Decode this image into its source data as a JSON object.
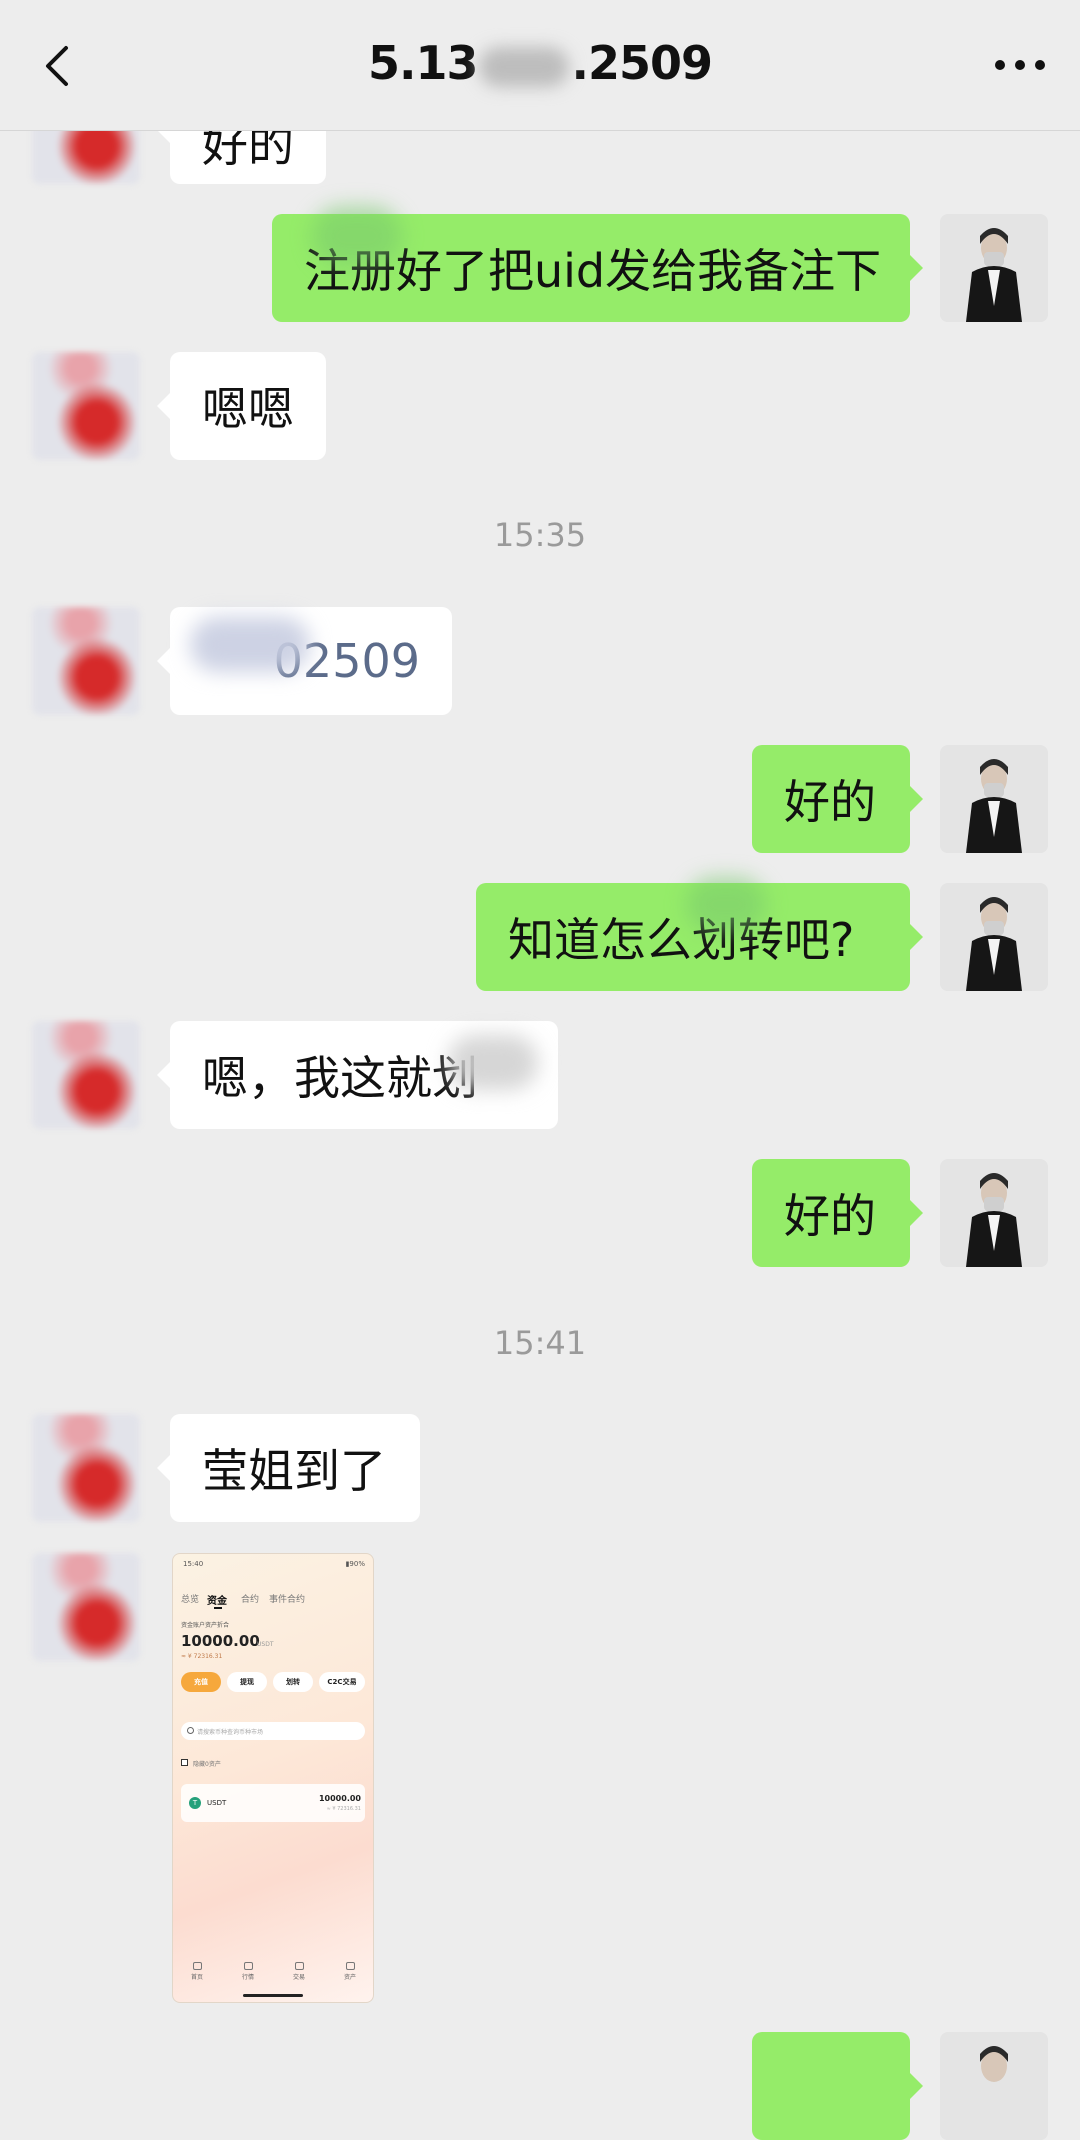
{
  "header": {
    "back_icon": "chevron-left-icon",
    "title_prefix": "5.13",
    "title_suffix": ".2509",
    "more_icon": "more-dots-icon"
  },
  "messages": [
    {
      "side": "left",
      "text": "好的"
    },
    {
      "side": "right",
      "text": "注册好了把uid发给我备注下"
    },
    {
      "side": "left",
      "text": "嗯嗯"
    },
    {
      "side": "left",
      "text": "02509"
    },
    {
      "side": "right",
      "text": "好的"
    },
    {
      "side": "right",
      "text": "知道怎么划转吧?"
    },
    {
      "side": "left",
      "text": "嗯，我这就划"
    },
    {
      "side": "right",
      "text": "好的"
    },
    {
      "side": "left",
      "text": "莹姐到了"
    }
  ],
  "timestamps": [
    "15:35",
    "15:41"
  ],
  "screenshot": {
    "status_time": "15:40",
    "battery": "▮90%",
    "tabs": [
      "总览",
      "资金",
      "合约",
      "事件合约"
    ],
    "active_tab": "资金",
    "account_label": "资金账户资产折合",
    "balance": "10000.00",
    "balance_unit": "USDT",
    "approx": "≈ ¥ 72316.31",
    "actions": [
      "充值",
      "提现",
      "划转",
      "C2C交易"
    ],
    "search_placeholder": "请搜索币种查询币种市场",
    "hide_zero": "隐藏0资产",
    "coin_name": "USDT",
    "coin_amount": "10000.00",
    "coin_sub": "≈ ¥ 72316.31",
    "nav": [
      "首页",
      "行情",
      "交易",
      "资产"
    ]
  },
  "colors": {
    "background": "#ededed",
    "bubble_me": "#95ec69",
    "bubble_them": "#ffffff",
    "timestamp": "#9a9a9a"
  }
}
